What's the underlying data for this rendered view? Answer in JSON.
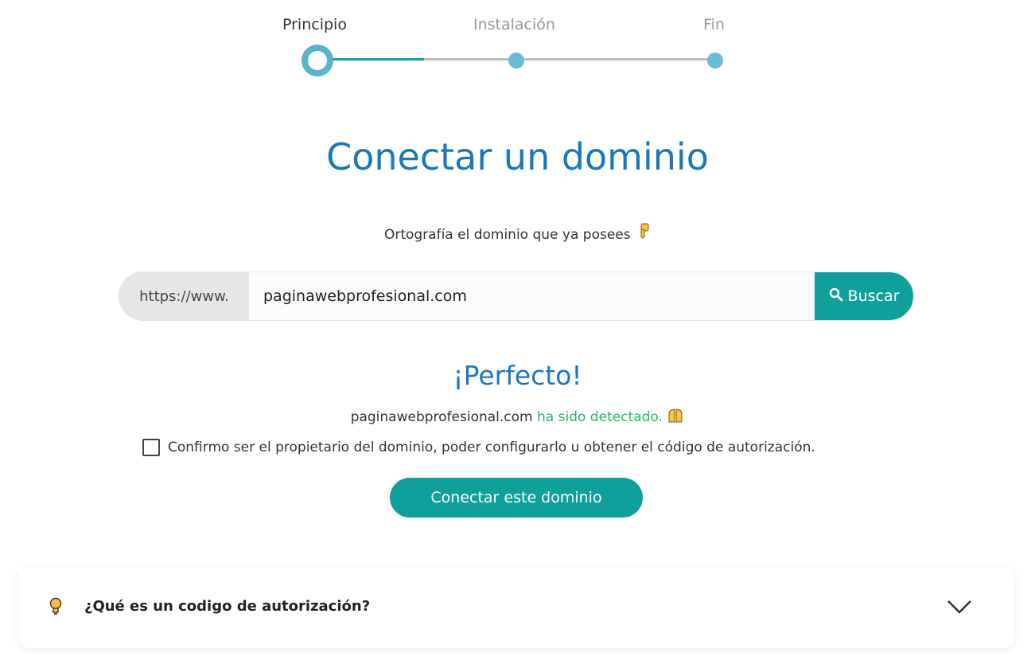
{
  "stepper": {
    "steps": [
      "Principio",
      "Instalación",
      "Fin"
    ],
    "current_step": 1
  },
  "title": "Conectar un dominio",
  "hint": "Ortografía el dominio que ya posees",
  "search": {
    "prefix": "https://www.",
    "value": "paginawebprofesional.com",
    "button_label": "Buscar"
  },
  "result": {
    "heading": "¡Perfecto!",
    "domain": "paginawebprofesional.com",
    "status": "ha sido detectado."
  },
  "confirm_label": "Confirmo ser el propietario del dominio, poder configurarlo u obtener el código de autorización.",
  "connect_button": "Conectar este dominio",
  "faq": {
    "question": "¿Qué es un codigo de autorización?"
  },
  "colors": {
    "accent": "#0fa09b",
    "title": "#1b78b8",
    "success": "#29b36a"
  }
}
